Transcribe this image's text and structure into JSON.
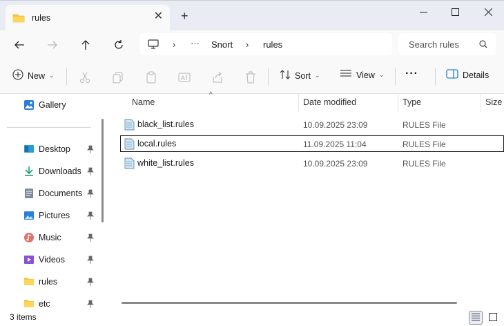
{
  "window": {
    "tab_title": "rules",
    "tab_close_icon": "close-icon",
    "newtab_icon": "plus-icon"
  },
  "nav": {
    "breadcrumb": [
      "Snort",
      "rules"
    ],
    "ellipsis": "···",
    "search_placeholder": "Search rules"
  },
  "toolbar": {
    "new_label": "New",
    "sort_label": "Sort",
    "view_label": "View",
    "more_label": "···",
    "details_label": "Details"
  },
  "sidebar": {
    "gallery": "Gallery",
    "items": [
      {
        "label": "Desktop",
        "icon": "desktop-icon"
      },
      {
        "label": "Downloads",
        "icon": "download-icon"
      },
      {
        "label": "Documents",
        "icon": "document-icon"
      },
      {
        "label": "Pictures",
        "icon": "pictures-icon"
      },
      {
        "label": "Music",
        "icon": "music-icon"
      },
      {
        "label": "Videos",
        "icon": "videos-icon"
      },
      {
        "label": "rules",
        "icon": "folder-icon"
      },
      {
        "label": "etc",
        "icon": "folder-icon"
      }
    ]
  },
  "table": {
    "columns": {
      "name": "Name",
      "date": "Date modified",
      "type": "Type",
      "size": "Size"
    },
    "rows": [
      {
        "name": "black_list.rules",
        "date": "10.09.2025 23:09",
        "type": "RULES File"
      },
      {
        "name": "local.rules",
        "date": "11.09.2025 11:04",
        "type": "RULES File",
        "selected": true
      },
      {
        "name": "white_list.rules",
        "date": "10.09.2025 23:09",
        "type": "RULES File"
      }
    ]
  },
  "status": {
    "item_count": "3 items"
  },
  "colors": {
    "accent": "#0067c0",
    "folder": "#f5c842",
    "titlebar": "#e9edf3"
  }
}
